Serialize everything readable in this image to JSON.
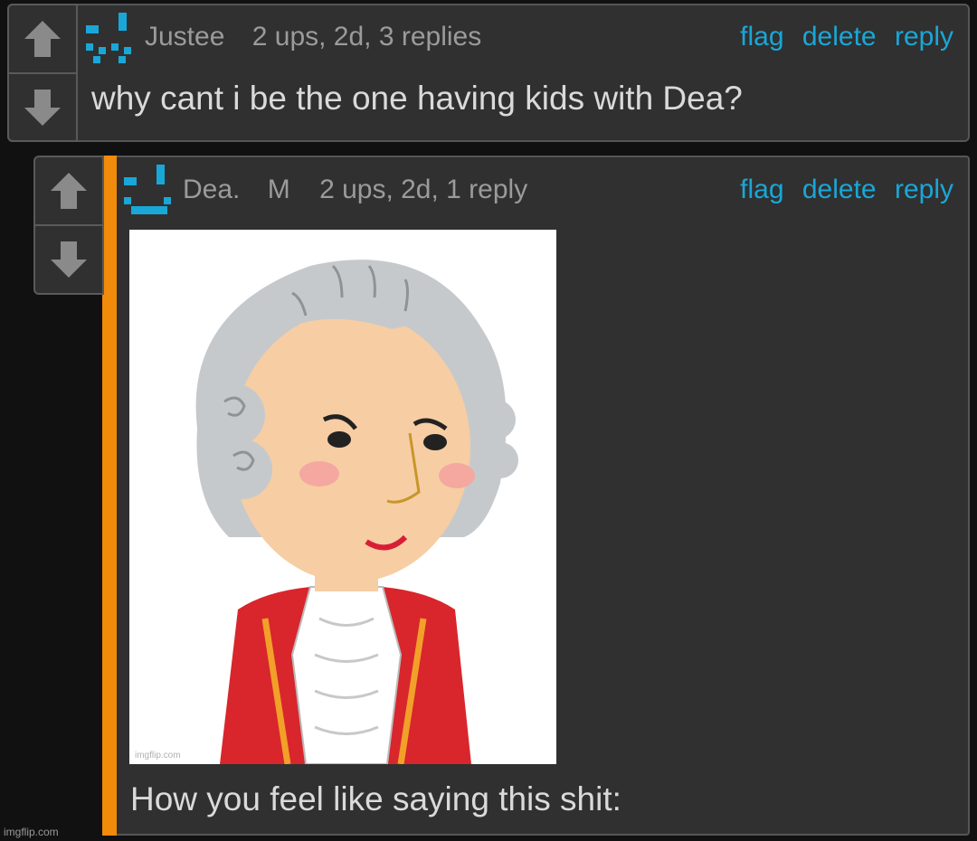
{
  "comments": [
    {
      "username": "Justee",
      "meta": "2 ups, 2d, 3 replies",
      "actions": {
        "flag": "flag",
        "delete": "delete",
        "reply": "reply"
      },
      "text": "why cant i be the one having kids with Dea?"
    },
    {
      "username": "Dea.",
      "badge": "M",
      "meta": "2 ups, 2d, 1 reply",
      "actions": {
        "flag": "flag",
        "delete": "delete",
        "reply": "reply"
      },
      "text": "How you feel like saying this shit:",
      "image_watermark": "imgflip.com"
    }
  ],
  "site_watermark": "imgflip.com",
  "colors": {
    "link": "#19a7d8",
    "reply_accent": "#f28a0a",
    "avatar": "#19a7d8"
  },
  "icons": [
    "upvote-arrow-icon",
    "downvote-arrow-icon",
    "pixel-avatar-icon"
  ]
}
